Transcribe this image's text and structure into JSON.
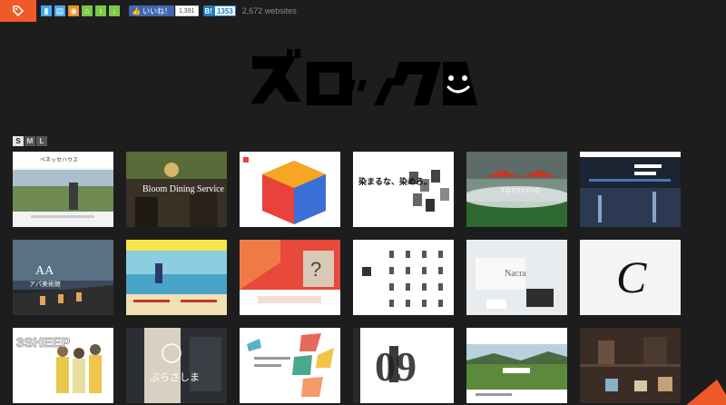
{
  "topbar": {
    "tag_icon": "tag-icon",
    "share_icons": [
      {
        "name": "bookmark-icon",
        "color": "#3fa9f5"
      },
      {
        "name": "book-icon",
        "color": "#3fa9f5"
      },
      {
        "name": "rss-icon",
        "color": "#f58c24"
      },
      {
        "name": "home-icon",
        "color": "#7ac943"
      },
      {
        "name": "info-icon",
        "color": "#7ac943"
      },
      {
        "name": "download-icon",
        "color": "#7ac943"
      }
    ],
    "like_label": "いいね！",
    "like_count": "1,391",
    "hatena_label": "B!",
    "hatena_count": "1353",
    "site_count": "2,672 websites"
  },
  "size_switch": [
    "S",
    "M",
    "L"
  ],
  "thumbnails": [
    {
      "caption": "ベネッセハウス",
      "tone": "#f3f3f3"
    },
    {
      "caption": "Bloom Dining Service",
      "tone": "#3a3126"
    },
    {
      "caption": "",
      "tone": "#ffffff"
    },
    {
      "caption": "染まるな、染めろ。",
      "tone": "#ffffff"
    },
    {
      "caption": "TOSTUDIO",
      "tone": "#3f5a4a"
    },
    {
      "caption": "",
      "tone": "#1b2433"
    },
    {
      "caption": "アパ美術館",
      "tone": "#2f3b4a"
    },
    {
      "caption": "",
      "tone": "#8dcde0"
    },
    {
      "caption": "",
      "tone": "#e8493a"
    },
    {
      "caption": "",
      "tone": "#ffffff"
    },
    {
      "caption": "Nacra",
      "tone": "#e9ecee"
    },
    {
      "caption": "C",
      "tone": "#f4f4f4"
    },
    {
      "caption": "3SHEEP",
      "tone": "#ffffff"
    },
    {
      "caption": "ぷらさしま",
      "tone": "#2b2e33"
    },
    {
      "caption": "",
      "tone": "#ffffff"
    },
    {
      "caption": "09",
      "tone": "#ffffff"
    },
    {
      "caption": "",
      "tone": "#ffffff"
    },
    {
      "caption": "",
      "tone": "#3b2c25"
    }
  ]
}
